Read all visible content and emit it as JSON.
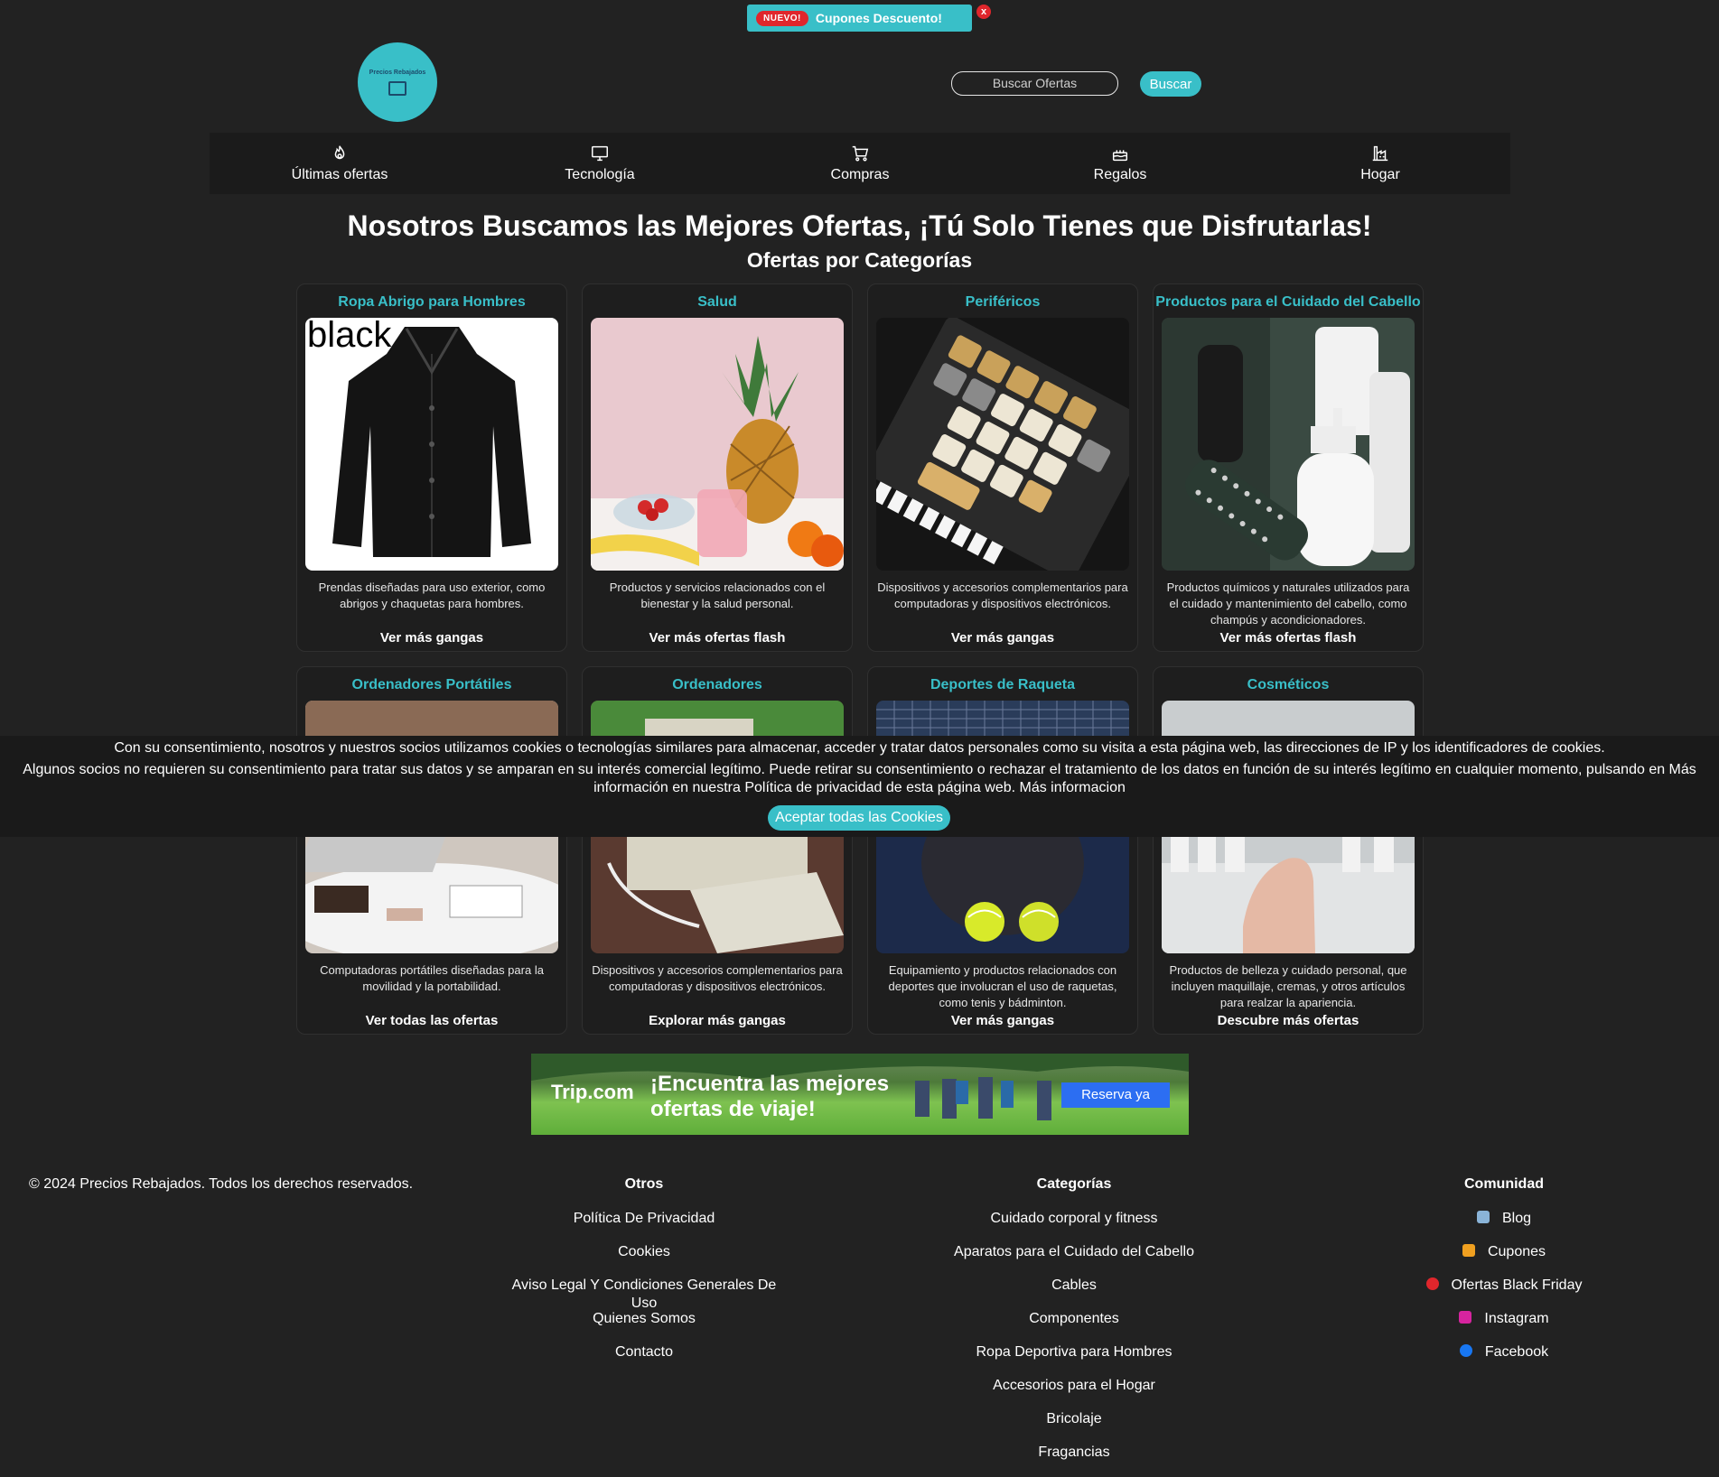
{
  "promo": {
    "badge": "NUEVO!",
    "text": "Cupones Descuento!",
    "close": "x"
  },
  "logo": {
    "text": "Precios Rebajados"
  },
  "search": {
    "placeholder": "Buscar Ofertas",
    "button": "Buscar"
  },
  "nav": [
    {
      "label": "Últimas ofertas",
      "icon": "flame-icon"
    },
    {
      "label": "Tecnología",
      "icon": "monitor-icon"
    },
    {
      "label": "Compras",
      "icon": "cart-icon"
    },
    {
      "label": "Regalos",
      "icon": "cake-icon"
    },
    {
      "label": "Hogar",
      "icon": "factory-icon"
    }
  ],
  "headline": "Nosotros Buscamos las Mejores Ofertas, ¡Tú Solo Tienes que Disfrutarlas!",
  "subheadline": "Ofertas por Categorías",
  "cards": [
    {
      "title": "Ropa Abrigo para Hombres",
      "img_text": "black",
      "desc": "Prendas diseñadas para uso exterior, como abrigos y chaquetas para hombres.",
      "link": "Ver más gangas"
    },
    {
      "title": "Salud",
      "desc": "Productos y servicios relacionados con el bienestar y la salud personal.",
      "link": "Ver más ofertas flash"
    },
    {
      "title": "Periféricos",
      "desc": "Dispositivos y accesorios complementarios para computadoras y dispositivos electrónicos.",
      "link": "Ver más gangas"
    },
    {
      "title": "Productos para el Cuidado del Cabello",
      "desc": "Productos químicos y naturales utilizados para el cuidado y mantenimiento del cabello, como champús y acondicionadores.",
      "link": "Ver más ofertas flash"
    },
    {
      "title": "Ordenadores Portátiles",
      "desc": "Computadoras portátiles diseñadas para la movilidad y la portabilidad.",
      "link": "Ver todas las ofertas"
    },
    {
      "title": "Ordenadores",
      "desc": "Dispositivos y accesorios complementarios para computadoras y dispositivos electrónicos.",
      "link": "Explorar más gangas"
    },
    {
      "title": "Deportes de Raqueta",
      "desc": "Equipamiento y productos relacionados con deportes que involucran el uso de raquetas, como tenis y bádminton.",
      "link": "Ver más gangas"
    },
    {
      "title": "Cosméticos",
      "desc": "Productos de belleza y cuidado personal, que incluyen maquillaje, cremas, y otros artículos para realzar la apariencia.",
      "link": "Descubre más ofertas"
    }
  ],
  "cookie": {
    "line1": "Con su consentimiento, nosotros y nuestros socios utilizamos cookies o tecnologías similares para almacenar, acceder y tratar datos personales como su visita a esta página web, las direcciones de IP y los identificadores de cookies.",
    "line2": "Algunos socios no requieren su consentimiento para tratar sus datos y se amparan en su interés comercial legítimo. Puede retirar su consentimiento o rechazar el tratamiento de los datos en función de su interés legítimo en cualquier momento, pulsando en Más información en nuestra Política de privacidad de esta página web. Más informacion",
    "button": "Aceptar todas las Cookies"
  },
  "ad": {
    "brand": "Trip.com",
    "slogan1": "¡Encuentra las mejores",
    "slogan2": "ofertas de viaje!",
    "button": "Reserva ya"
  },
  "footer": {
    "copyright": "© 2024 Precios Rebajados. Todos los derechos reservados.",
    "otros": {
      "title": "Otros",
      "links": [
        "Política De Privacidad",
        "Cookies",
        "Aviso Legal Y Condiciones Generales De Uso",
        "Quienes Somos",
        "Contacto"
      ]
    },
    "categorias": {
      "title": "Categorías",
      "links": [
        "Cuidado corporal y fitness",
        "Aparatos para el Cuidado del Cabello",
        "Cables",
        "Componentes",
        "Ropa Deportiva para Hombres",
        "Accesorios para el Hogar",
        "Bricolaje",
        "Fragancias"
      ]
    },
    "comunidad": {
      "title": "Comunidad",
      "links": [
        {
          "label": "Blog",
          "color": "#8ab4d8"
        },
        {
          "label": "Cupones",
          "color": "#f0a020"
        },
        {
          "label": "Ofertas Black Friday",
          "color": "#e0262c"
        },
        {
          "label": "Instagram",
          "color": "#d6249f"
        },
        {
          "label": "Facebook",
          "color": "#1877f2"
        }
      ]
    }
  },
  "colors": {
    "accent": "#39bfc8",
    "background": "#222222",
    "badge": "#e0262c"
  }
}
